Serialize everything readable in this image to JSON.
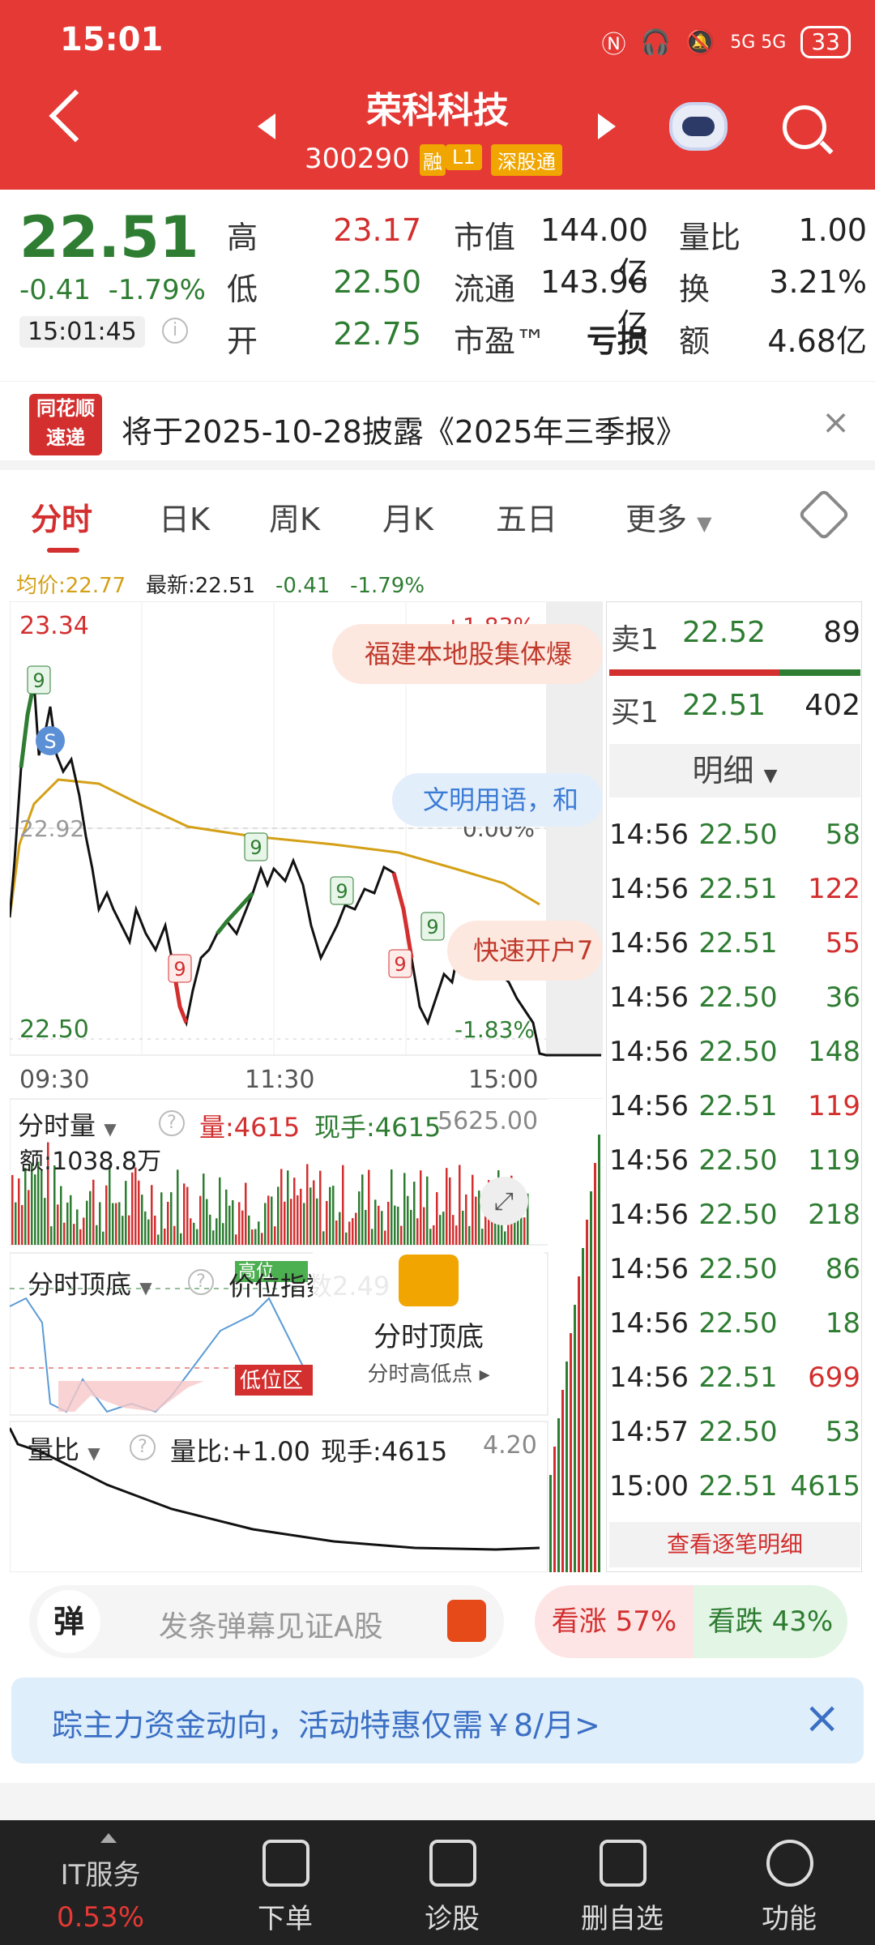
{
  "status_bar": {
    "time": "15:01",
    "network": "5G 5G",
    "battery": "33"
  },
  "header": {
    "title": "荣科科技",
    "code": "300290",
    "tags": [
      "融",
      "L1",
      "深股通"
    ]
  },
  "quote": {
    "price": "22.51",
    "change": "-0.41",
    "change_pct": "-1.79%",
    "time": "15:01:45",
    "rows": [
      {
        "l1": "高",
        "v1": "23.17",
        "l2": "市值",
        "v2": "144.00亿",
        "l3": "量比",
        "v3": "1.00"
      },
      {
        "l1": "低",
        "v1": "22.50",
        "l2": "流通",
        "v2": "143.96亿",
        "l3": "换",
        "v3": "3.21%"
      },
      {
        "l1": "开",
        "v1": "22.75",
        "l2": "市盈™",
        "v2": "亏损",
        "l3": "额",
        "v3": "4.68亿"
      }
    ]
  },
  "notice": {
    "logo_top": "同花顺",
    "logo_bottom": "速递",
    "text": "将于2025-10-28披露《2025年三季报》"
  },
  "tabs": [
    "分时",
    "日K",
    "周K",
    "月K",
    "五日",
    "更多"
  ],
  "legend": {
    "avg": "均价:22.77",
    "latest": "最新:22.51",
    "chg": "-0.41",
    "pct": "-1.79%"
  },
  "chart": {
    "ymax": "23.34",
    "ymin": "22.50",
    "mid": "22.92",
    "pct_top": "+1.83%",
    "pct_mid": "0.00%",
    "pct_bot": "-1.83%",
    "times": [
      "09:30",
      "11:30",
      "15:00"
    ],
    "news1": "福建本地股集体爆",
    "news2": "文明用语，和",
    "news3": "快速开户7",
    "s_marker": "S",
    "nine": "9"
  },
  "vol_panel": {
    "label": "分时量",
    "vol": "量:4615",
    "hand": "现手:4615",
    "max": "5625.00",
    "amount": "额:1038.8万"
  },
  "topbottom": {
    "label": "分时顶底",
    "index": "价位指数2.49",
    "low": "低位区",
    "high": "高位",
    "card_title": "分时顶底",
    "card_sub": "分时高低点"
  },
  "ratio_panel": {
    "label": "量比",
    "ratio": "量比:+1.00",
    "hand": "现手:4615",
    "max": "4.20"
  },
  "orderbook": {
    "sell": {
      "label": "卖1",
      "price": "22.52",
      "vol": "89"
    },
    "buy": {
      "label": "买1",
      "price": "22.51",
      "vol": "402"
    },
    "detail_label": "明细",
    "rows": [
      {
        "t": "14:56",
        "p": "22.50",
        "v": "58",
        "c": "green"
      },
      {
        "t": "14:56",
        "p": "22.51",
        "v": "122",
        "c": "red"
      },
      {
        "t": "14:56",
        "p": "22.51",
        "v": "55",
        "c": "red"
      },
      {
        "t": "14:56",
        "p": "22.50",
        "v": "36",
        "c": "green"
      },
      {
        "t": "14:56",
        "p": "22.50",
        "v": "148",
        "c": "green"
      },
      {
        "t": "14:56",
        "p": "22.51",
        "v": "119",
        "c": "red"
      },
      {
        "t": "14:56",
        "p": "22.50",
        "v": "119",
        "c": "green"
      },
      {
        "t": "14:56",
        "p": "22.50",
        "v": "218",
        "c": "green"
      },
      {
        "t": "14:56",
        "p": "22.50",
        "v": "86",
        "c": "green"
      },
      {
        "t": "14:56",
        "p": "22.50",
        "v": "18",
        "c": "green"
      },
      {
        "t": "14:56",
        "p": "22.51",
        "v": "699",
        "c": "red"
      },
      {
        "t": "14:57",
        "p": "22.50",
        "v": "53",
        "c": "green"
      },
      {
        "t": "15:00",
        "p": "22.51",
        "v": "4615",
        "c": "green"
      }
    ],
    "view_all": "查看逐笔明细"
  },
  "danmu": {
    "icon": "弹",
    "placeholder": "发条弹幕见证A股",
    "up": "看涨 57%",
    "down": "看跌 43%"
  },
  "promo": {
    "text": "踪主力资金动向，活动特惠仅需￥8/月>"
  },
  "nav": {
    "sector": "IT服务",
    "sector_pct": "0.53%",
    "items": [
      "下单",
      "诊股",
      "删自选",
      "功能"
    ]
  },
  "colors": {
    "header_red": "#e53935",
    "up_red": "#d32f2f",
    "down_green": "#2e7d32",
    "avg_line": "#d4a017"
  }
}
